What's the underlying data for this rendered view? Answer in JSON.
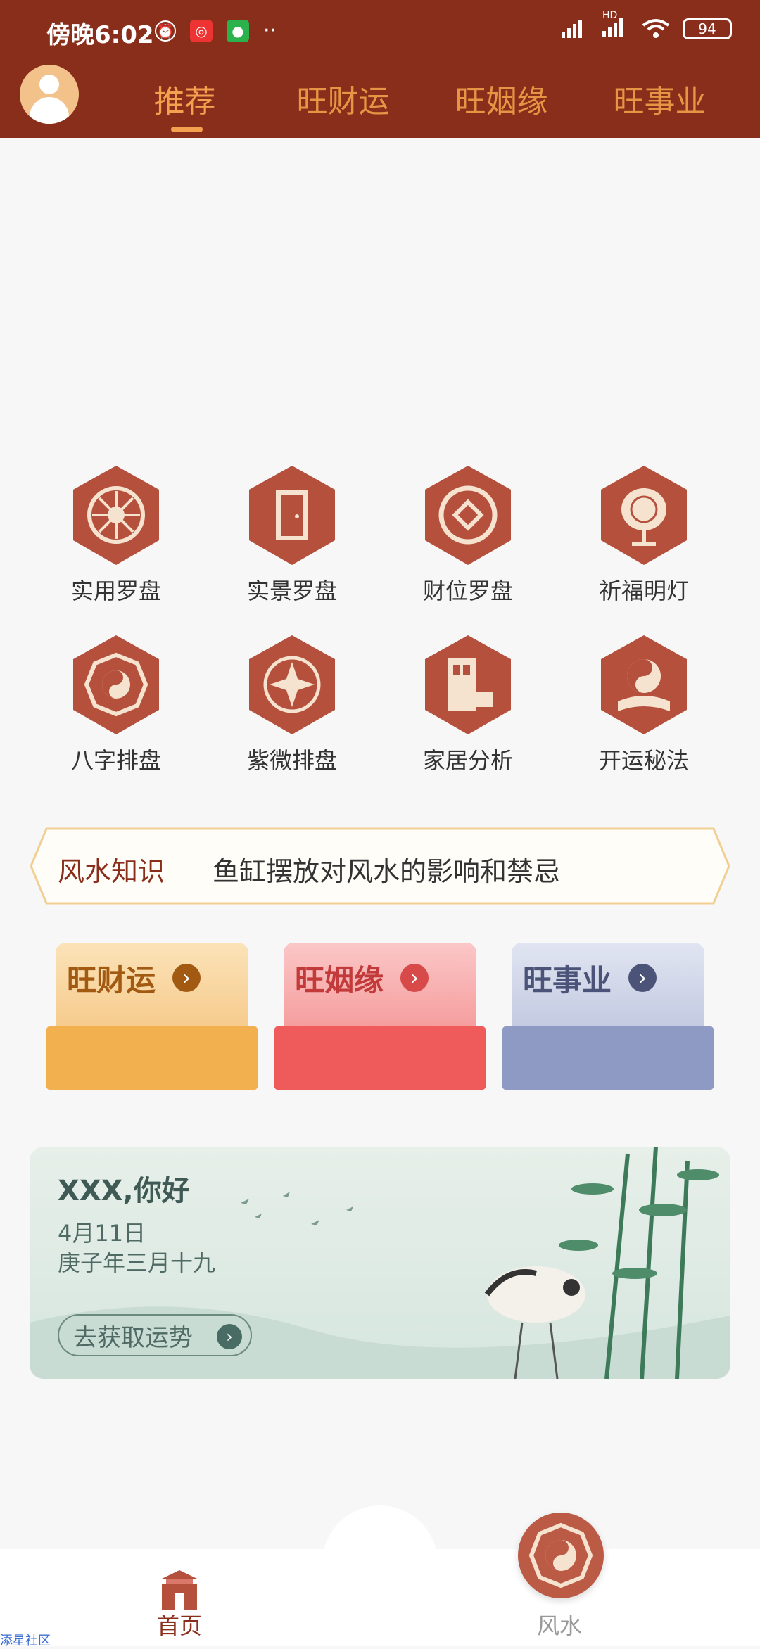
{
  "status_bar": {
    "time": "傍晚6:02",
    "battery": "94",
    "hd_label": "HD"
  },
  "header": {
    "tabs": [
      {
        "label": "推荐",
        "active": true
      },
      {
        "label": "旺财运",
        "active": false
      },
      {
        "label": "旺姻缘",
        "active": false
      },
      {
        "label": "旺事业",
        "active": false
      }
    ]
  },
  "tools": [
    {
      "label": "实用罗盘",
      "icon": "compass-icon"
    },
    {
      "label": "实景罗盘",
      "icon": "door-icon"
    },
    {
      "label": "财位罗盘",
      "icon": "coin-icon"
    },
    {
      "label": "祈福明灯",
      "icon": "lamp-icon"
    },
    {
      "label": "八字排盘",
      "icon": "bagua-icon"
    },
    {
      "label": "紫微排盘",
      "icon": "star-compass-icon"
    },
    {
      "label": "家居分析",
      "icon": "home-layout-icon"
    },
    {
      "label": "开运秘法",
      "icon": "yinyang-book-icon"
    }
  ],
  "knowledge": {
    "title": "风水知识",
    "text": "鱼缸摆放对风水的影响和禁忌"
  },
  "cards": [
    {
      "label": "旺财运",
      "color": "#f2b04f"
    },
    {
      "label": "旺姻缘",
      "color": "#ef5a5a"
    },
    {
      "label": "旺事业",
      "color": "#8f9ac4"
    }
  ],
  "banner": {
    "greeting": "XXX,你好",
    "date": "4月11日",
    "lunar": "庚子年三月十九",
    "button": "去获取运势"
  },
  "nav": {
    "home": "首页",
    "fengshui": "风水"
  },
  "watermark": "添星社区"
}
